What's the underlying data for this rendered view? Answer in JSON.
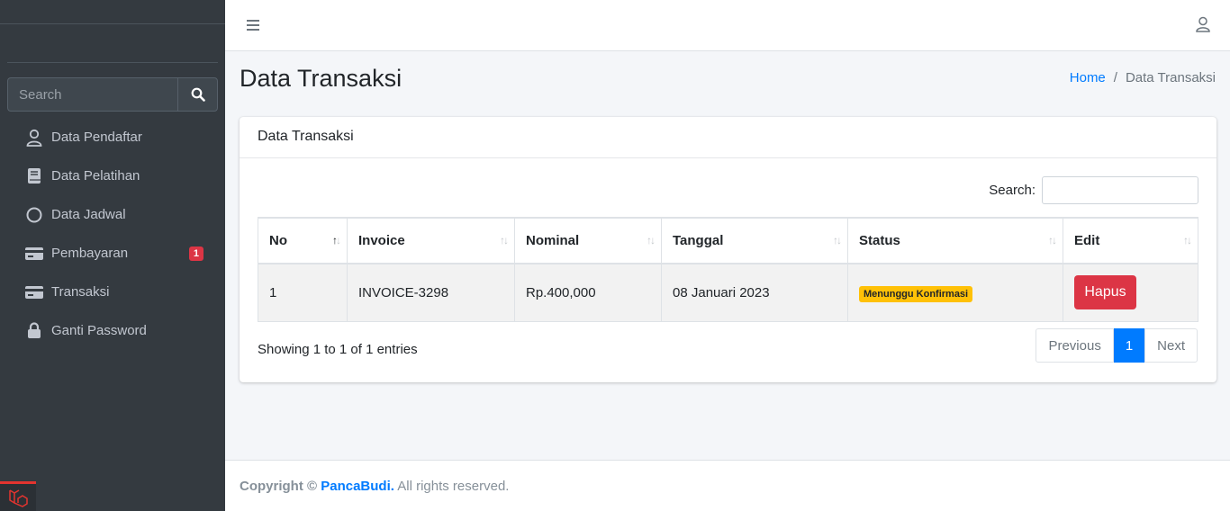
{
  "sidebar": {
    "search_placeholder": "Search",
    "items": [
      {
        "label": "Data Pendaftar",
        "icon": "user-icon"
      },
      {
        "label": "Data Pelatihan",
        "icon": "book-icon"
      },
      {
        "label": "Data Jadwal",
        "icon": "circle-icon"
      },
      {
        "label": "Pembayaran",
        "icon": "credit-card-icon",
        "badge": "1"
      },
      {
        "label": "Transaksi",
        "icon": "credit-card-icon"
      },
      {
        "label": "Ganti Password",
        "icon": "lock-icon"
      }
    ]
  },
  "header": {
    "menu_icon": "hamburger-icon",
    "user_icon": "user-icon"
  },
  "page": {
    "title": "Data Transaksi",
    "breadcrumb": {
      "home": "Home",
      "separator": "/",
      "current": "Data Transaksi"
    }
  },
  "card": {
    "title": "Data Transaksi",
    "search_label": "Search:",
    "search_value": "",
    "columns": [
      "No",
      "Invoice",
      "Nominal",
      "Tanggal",
      "Status",
      "Edit"
    ],
    "rows": [
      {
        "no": "1",
        "invoice": "INVOICE-3298",
        "nominal": "Rp.400,000",
        "tanggal": "08 Januari 2023",
        "status": "Menunggu Konfirmasi",
        "action": "Hapus"
      }
    ],
    "info": "Showing 1 to 1 of 1 entries",
    "pagination": {
      "previous": "Previous",
      "current": "1",
      "next": "Next"
    }
  },
  "footer": {
    "prefix": "Copyright ©",
    "brand": "PancaBudi.",
    "suffix": "All rights reserved."
  },
  "colors": {
    "sidebar_bg": "#343a40",
    "primary": "#007bff",
    "danger": "#dc3545",
    "warning": "#ffc107"
  }
}
